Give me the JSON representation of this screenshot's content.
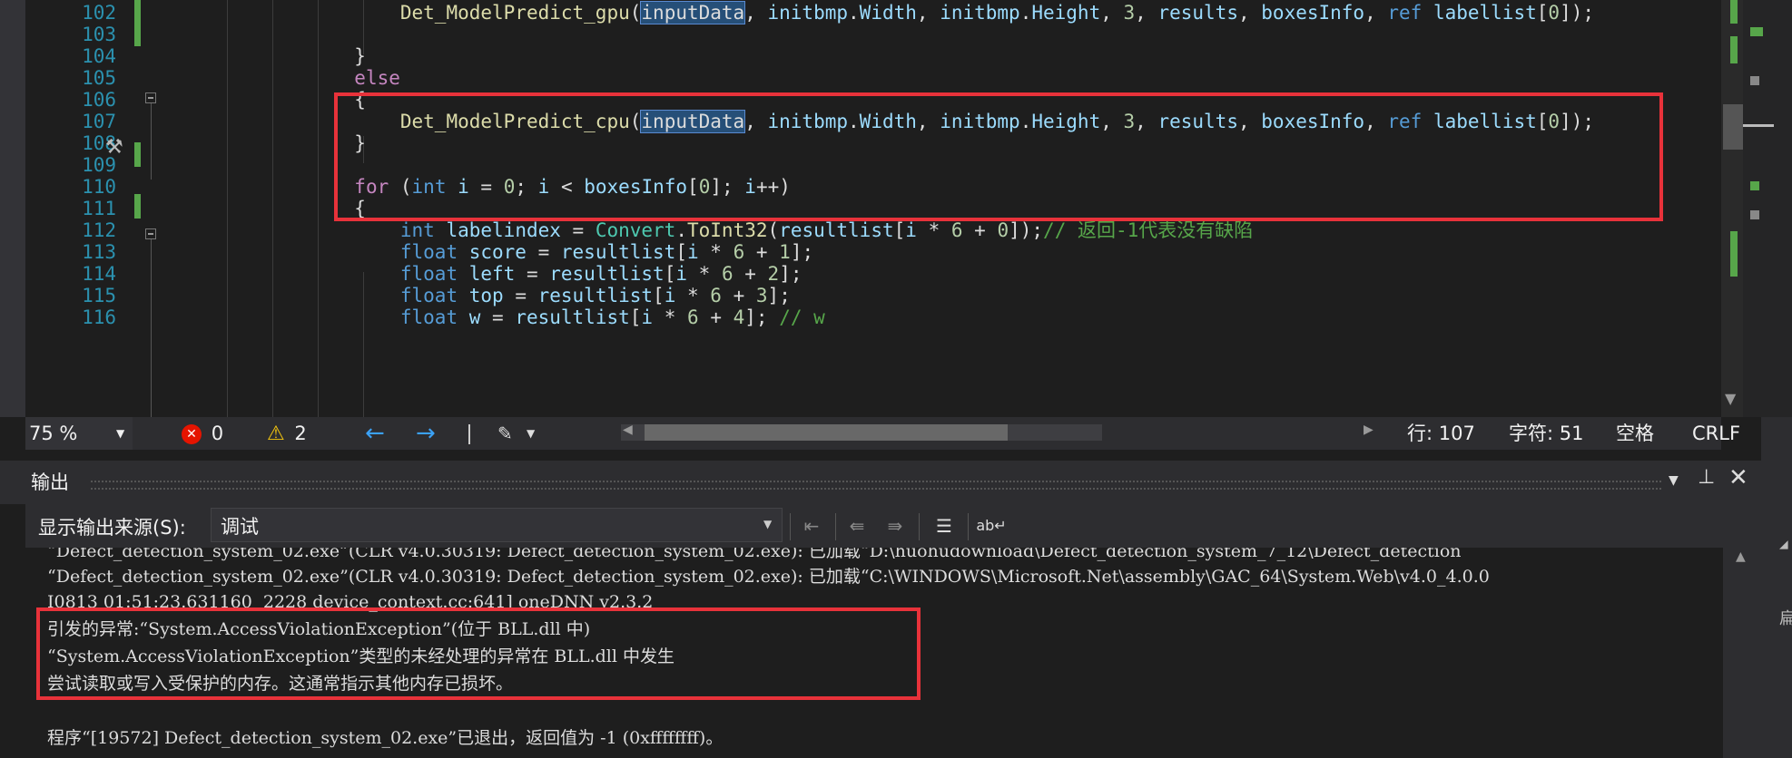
{
  "editor": {
    "lines": [
      {
        "n": "102",
        "indent": "    ",
        "tokens": [
          [
            "fn",
            "Det_ModelPredict_gpu"
          ],
          [
            "p",
            "("
          ],
          [
            "hl",
            "inputData"
          ],
          [
            "p",
            ", "
          ],
          [
            "vr",
            "initbmp"
          ],
          [
            "p",
            "."
          ],
          [
            "vr",
            "Width"
          ],
          [
            "p",
            ", "
          ],
          [
            "vr",
            "initbmp"
          ],
          [
            "p",
            "."
          ],
          [
            "vr",
            "Height"
          ],
          [
            "p",
            ", "
          ],
          [
            "nm",
            "3"
          ],
          [
            "p",
            ", "
          ],
          [
            "vr",
            "results"
          ],
          [
            "p",
            ", "
          ],
          [
            "vr",
            "boxesInfo"
          ],
          [
            "p",
            ", "
          ],
          [
            "kw",
            "ref "
          ],
          [
            "vr",
            "labellist"
          ],
          [
            "p",
            "["
          ],
          [
            "nm",
            "0"
          ],
          [
            "p",
            "]);"
          ]
        ]
      },
      {
        "n": "103",
        "indent": "",
        "tokens": []
      },
      {
        "n": "104",
        "indent": "",
        "tokens": [
          [
            "p",
            "}"
          ]
        ]
      },
      {
        "n": "105",
        "indent": "",
        "tokens": [
          [
            "ctl",
            "else"
          ]
        ]
      },
      {
        "n": "106",
        "indent": "",
        "tokens": [
          [
            "p",
            "{"
          ]
        ]
      },
      {
        "n": "107",
        "indent": "    ",
        "tokens": [
          [
            "fn",
            "Det_ModelPredict_cpu"
          ],
          [
            "p",
            "("
          ],
          [
            "hl",
            "inputData"
          ],
          [
            "p",
            ", "
          ],
          [
            "vr",
            "initbmp"
          ],
          [
            "p",
            "."
          ],
          [
            "vr",
            "Width"
          ],
          [
            "p",
            ", "
          ],
          [
            "vr",
            "initbmp"
          ],
          [
            "p",
            "."
          ],
          [
            "vr",
            "Height"
          ],
          [
            "p",
            ", "
          ],
          [
            "nm",
            "3"
          ],
          [
            "p",
            ", "
          ],
          [
            "vr",
            "results"
          ],
          [
            "p",
            ", "
          ],
          [
            "vr",
            "boxesInfo"
          ],
          [
            "p",
            ", "
          ],
          [
            "kw",
            "ref "
          ],
          [
            "vr",
            "labellist"
          ],
          [
            "p",
            "["
          ],
          [
            "nm",
            "0"
          ],
          [
            "p",
            "]);"
          ]
        ]
      },
      {
        "n": "108",
        "indent": "",
        "tokens": [
          [
            "p",
            "}"
          ]
        ]
      },
      {
        "n": "109",
        "indent": "",
        "tokens": []
      },
      {
        "n": "110",
        "indent": "",
        "tokens": [
          [
            "ctl",
            "for"
          ],
          [
            "p",
            " ("
          ],
          [
            "kw",
            "int"
          ],
          [
            "vr",
            " i"
          ],
          [
            "p",
            " = "
          ],
          [
            "nm",
            "0"
          ],
          [
            "p",
            "; "
          ],
          [
            "vr",
            "i"
          ],
          [
            "p",
            " < "
          ],
          [
            "vr",
            "boxesInfo"
          ],
          [
            "p",
            "["
          ],
          [
            "nm",
            "0"
          ],
          [
            "p",
            "]; "
          ],
          [
            "vr",
            "i"
          ],
          [
            "p",
            "++)"
          ]
        ]
      },
      {
        "n": "111",
        "indent": "",
        "tokens": [
          [
            "p",
            "{"
          ]
        ]
      },
      {
        "n": "112",
        "indent": "    ",
        "tokens": [
          [
            "kw",
            "int"
          ],
          [
            "vr",
            " labelindex"
          ],
          [
            "p",
            " = "
          ],
          [
            "ty",
            "Convert"
          ],
          [
            "p",
            "."
          ],
          [
            "fn",
            "ToInt32"
          ],
          [
            "p",
            "("
          ],
          [
            "vr",
            "resultlist"
          ],
          [
            "p",
            "["
          ],
          [
            "vr",
            "i"
          ],
          [
            "p",
            " * "
          ],
          [
            "nm",
            "6"
          ],
          [
            "p",
            " + "
          ],
          [
            "nm",
            "0"
          ],
          [
            "p",
            "]);"
          ],
          [
            "cm",
            "// 返回-1代表没有缺陷"
          ]
        ]
      },
      {
        "n": "113",
        "indent": "    ",
        "tokens": [
          [
            "kw",
            "float"
          ],
          [
            "vr",
            " score"
          ],
          [
            "p",
            " = "
          ],
          [
            "vr",
            "resultlist"
          ],
          [
            "p",
            "["
          ],
          [
            "vr",
            "i"
          ],
          [
            "p",
            " * "
          ],
          [
            "nm",
            "6"
          ],
          [
            "p",
            " + "
          ],
          [
            "nm",
            "1"
          ],
          [
            "p",
            "];"
          ]
        ]
      },
      {
        "n": "114",
        "indent": "    ",
        "tokens": [
          [
            "kw",
            "float"
          ],
          [
            "vr",
            " left"
          ],
          [
            "p",
            " = "
          ],
          [
            "vr",
            "resultlist"
          ],
          [
            "p",
            "["
          ],
          [
            "vr",
            "i"
          ],
          [
            "p",
            " * "
          ],
          [
            "nm",
            "6"
          ],
          [
            "p",
            " + "
          ],
          [
            "nm",
            "2"
          ],
          [
            "p",
            "];"
          ]
        ]
      },
      {
        "n": "115",
        "indent": "    ",
        "tokens": [
          [
            "kw",
            "float"
          ],
          [
            "vr",
            " top"
          ],
          [
            "p",
            " = "
          ],
          [
            "vr",
            "resultlist"
          ],
          [
            "p",
            "["
          ],
          [
            "vr",
            "i"
          ],
          [
            "p",
            " * "
          ],
          [
            "nm",
            "6"
          ],
          [
            "p",
            " + "
          ],
          [
            "nm",
            "3"
          ],
          [
            "p",
            "];"
          ]
        ]
      },
      {
        "n": "116",
        "indent": "    ",
        "tokens": [
          [
            "kw",
            "float"
          ],
          [
            "vr",
            " w"
          ],
          [
            "p",
            " = "
          ],
          [
            "vr",
            "resultlist"
          ],
          [
            "p",
            "["
          ],
          [
            "vr",
            "i"
          ],
          [
            "p",
            " * "
          ],
          [
            "nm",
            "6"
          ],
          [
            "p",
            " + "
          ],
          [
            "nm",
            "4"
          ],
          [
            "p",
            "]; "
          ],
          [
            "cm",
            "// w"
          ]
        ]
      }
    ]
  },
  "statusbar": {
    "zoom": "75 %",
    "errors": "0",
    "warnings": "2",
    "line": "行: 107",
    "char": "字符: 51",
    "spaces": "空格",
    "eol": "CRLF"
  },
  "output": {
    "title": "输出",
    "source_label": "显示输出来源(S):",
    "source_value": "调试",
    "lines": [
      "“Defect_detection_system_02.exe”(CLR v4.0.30319: Defect_detection_system_02.exe): 已加载“D:\\huohudownload\\Defect_detection_system_7_12\\Defect_detection",
      "“Defect_detection_system_02.exe”(CLR v4.0.30319: Defect_detection_system_02.exe): 已加载“C:\\WINDOWS\\Microsoft.Net\\assembly\\GAC_64\\System.Web\\v4.0_4.0.0",
      "I0813 01:51:23.631160  2228 device_context.cc:641] oneDNN v2.3.2",
      "引发的异常:“System.AccessViolationException”(位于 BLL.dll 中)",
      "“System.AccessViolationException”类型的未经处理的异常在 BLL.dll 中发生",
      "尝试读取或写入受保护的内存。这通常指示其他内存已损坏。",
      "",
      "程序“[19572] Defect_detection_system_02.exe”已退出，返回值为 -1 (0xffffffff)。"
    ]
  },
  "colors": {
    "highlight_box": "#e8323a",
    "keyword": "#569cd6",
    "type": "#4ec9b0",
    "comment": "#57a64a"
  },
  "icons": [
    "error-icon",
    "warning-icon",
    "nav-back-icon",
    "nav-forward-icon",
    "brush-icon",
    "dropdown-arrow-icon",
    "pin-icon",
    "close-icon",
    "clear-all-icon",
    "word-wrap-icon"
  ]
}
